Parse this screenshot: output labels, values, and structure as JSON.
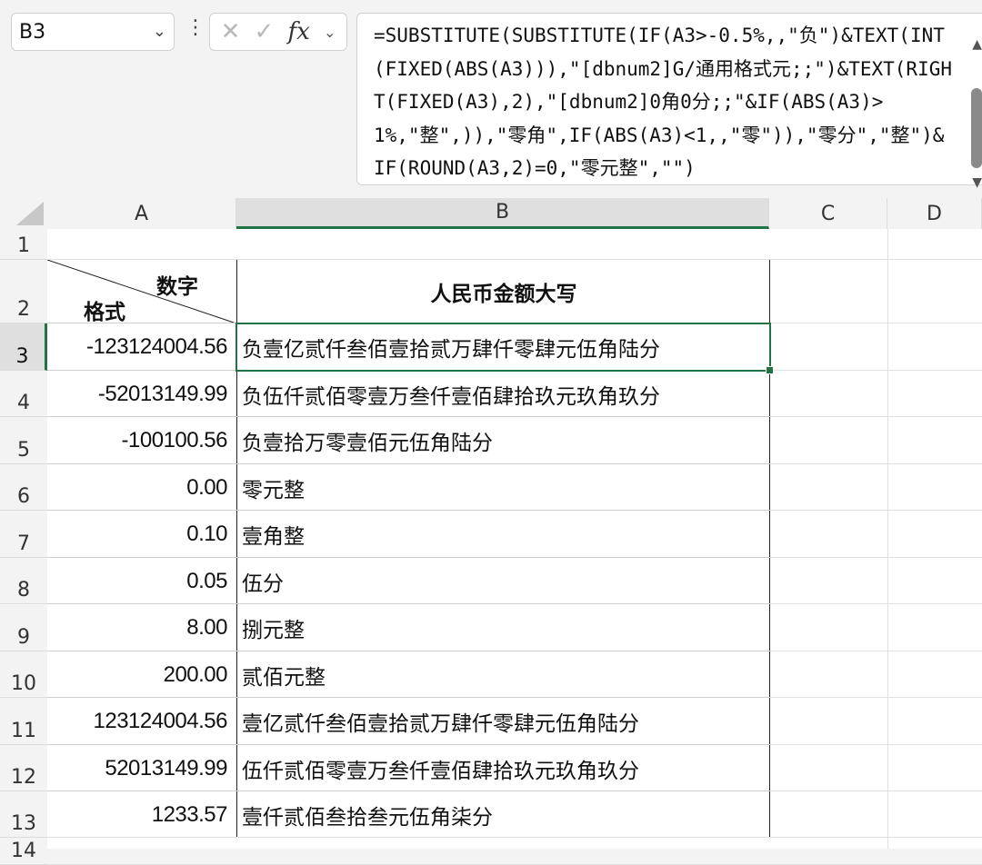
{
  "name_box": {
    "value": "B3"
  },
  "formula_bar": {
    "formula": "=SUBSTITUTE(SUBSTITUTE(IF(A3>-0.5%,,\"负\")&TEXT(INT(FIXED(ABS(A3))),\"[dbnum2]G/通用格式元;;\")&TEXT(RIGHT(FIXED(A3),2),\"[dbnum2]0角0分;;\"&IF(ABS(A3)>1%,\"整\",)),\"零角\",IF(ABS(A3)<1,,\"零\")),\"零分\",\"整\")&IF(ROUND(A3,2)=0,\"零元整\",\"\")",
    "icons": [
      "more-vertical-icon",
      "cancel-icon",
      "enter-icon",
      "fx-icon",
      "chevron-down-icon"
    ]
  },
  "columns": [
    "A",
    "B",
    "C",
    "D"
  ],
  "selected_column": "B",
  "selected_row": "3",
  "header_cells": {
    "a_top": "数字",
    "a_bottom": "格式",
    "b": "人民币金额大写"
  },
  "rows": [
    {
      "num": "1",
      "a": "",
      "b": ""
    },
    {
      "num": "2",
      "a": "",
      "b": ""
    },
    {
      "num": "3",
      "a": "-123124004.56",
      "b": "负壹亿贰仟叁佰壹拾贰万肆仟零肆元伍角陆分"
    },
    {
      "num": "4",
      "a": "-52013149.99",
      "b": "负伍仟贰佰零壹万叁仟壹佰肆拾玖元玖角玖分"
    },
    {
      "num": "5",
      "a": "-100100.56",
      "b": "负壹拾万零壹佰元伍角陆分"
    },
    {
      "num": "6",
      "a": "0.00",
      "b": "零元整"
    },
    {
      "num": "7",
      "a": "0.10",
      "b": "壹角整"
    },
    {
      "num": "8",
      "a": "0.05",
      "b": "伍分"
    },
    {
      "num": "9",
      "a": "8.00",
      "b": "捌元整"
    },
    {
      "num": "10",
      "a": "200.00",
      "b": "贰佰元整"
    },
    {
      "num": "11",
      "a": "123124004.56",
      "b": "壹亿贰仟叁佰壹拾贰万肆仟零肆元伍角陆分"
    },
    {
      "num": "12",
      "a": "52013149.99",
      "b": "伍仟贰佰零壹万叁仟壹佰肆拾玖元玖角玖分"
    },
    {
      "num": "13",
      "a": "1233.57",
      "b": "壹仟贰佰叁拾叁元伍角柒分"
    },
    {
      "num": "14",
      "a": "",
      "b": ""
    }
  ],
  "colors": {
    "accent": "#217346",
    "header_bg": "#f3f3f3",
    "selected_header_bg": "#dfdfdf"
  }
}
